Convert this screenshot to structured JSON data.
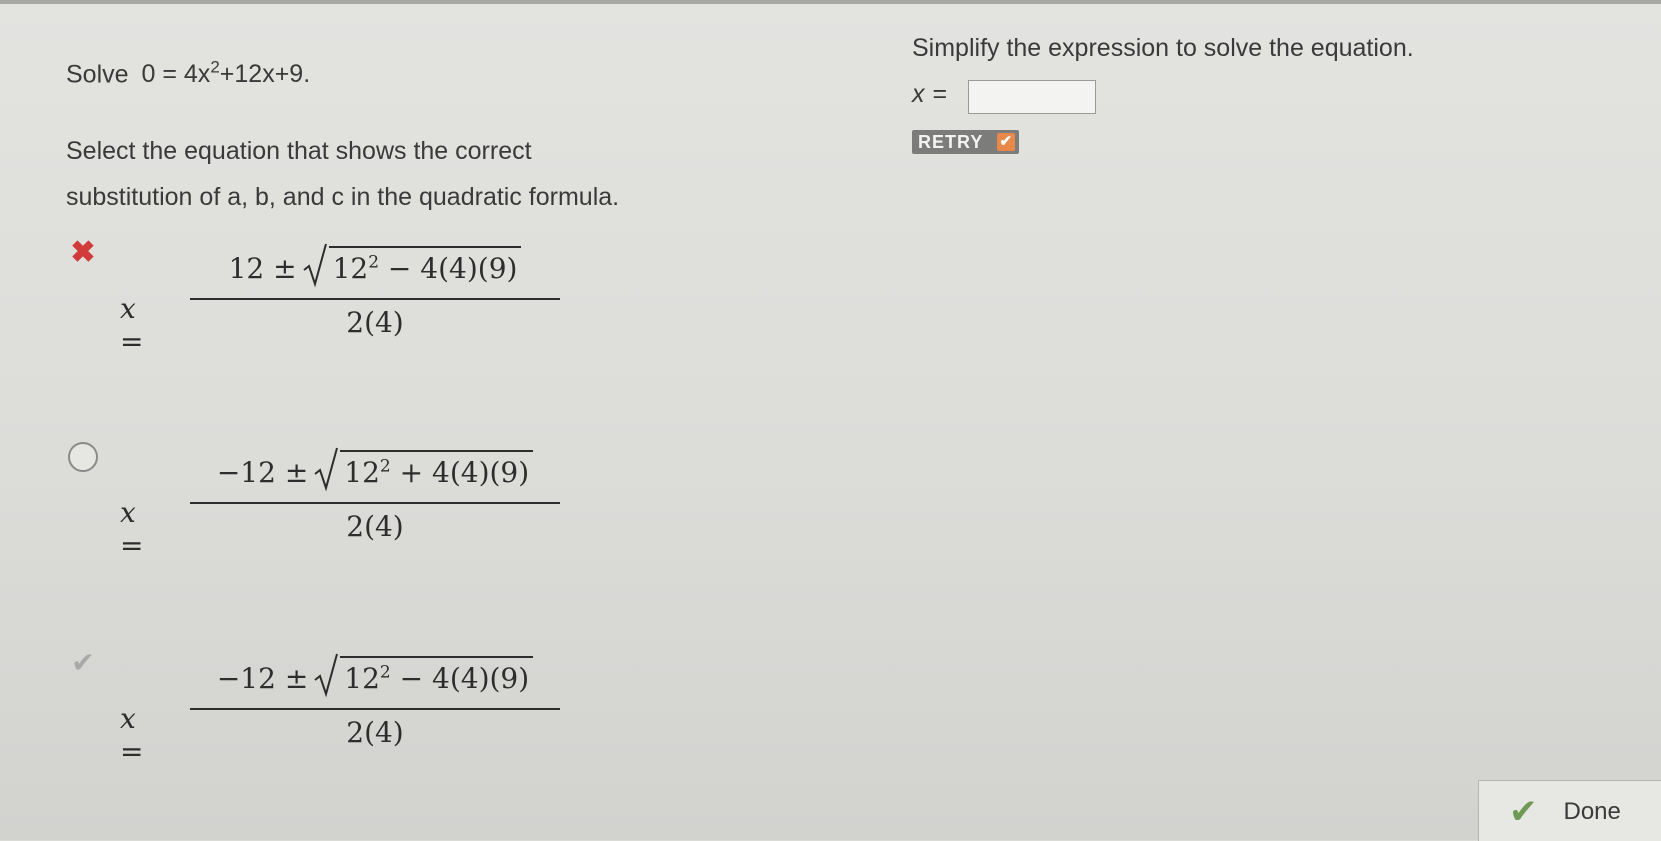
{
  "problem": {
    "prefix": "Solve",
    "equation_left": "0 = 4x",
    "equation_exp": "2",
    "equation_right": "+12x+9."
  },
  "prompt": {
    "line1": "Select the equation that shows the correct",
    "line2": "substitution of a, b, and c in the quadratic formula."
  },
  "options": [
    {
      "state": "wrong",
      "marker": "✖",
      "lhs": "x =",
      "numer_lead": "12 ±",
      "radicand_base": "12",
      "radicand_exp": "2",
      "radicand_rest": " − 4(4)(9)",
      "denominator": "2(4)"
    },
    {
      "state": "unselected",
      "marker": "",
      "lhs": "x =",
      "numer_lead": "−12 ±",
      "radicand_base": "12",
      "radicand_exp": "2",
      "radicand_rest": " + 4(4)(9)",
      "denominator": "2(4)"
    },
    {
      "state": "correct",
      "marker": "✔",
      "lhs": "x =",
      "numer_lead": "−12 ±",
      "radicand_base": "12",
      "radicand_exp": "2",
      "radicand_rest": " − 4(4)(9)",
      "denominator": "2(4)"
    }
  ],
  "right_panel": {
    "instruction": "Simplify the expression to solve the equation.",
    "answer_label": "x",
    "answer_eq": "=",
    "answer_value": "",
    "retry_label": "RETRY",
    "retry_icon": "✔"
  },
  "done": {
    "icon": "✔",
    "label": "Done"
  },
  "colors": {
    "background": "#dadad7",
    "wrong": "#d13b3b",
    "retry_badge": "#7c7c7a",
    "retry_check": "#e8884a",
    "done_check": "#6f9a55"
  }
}
